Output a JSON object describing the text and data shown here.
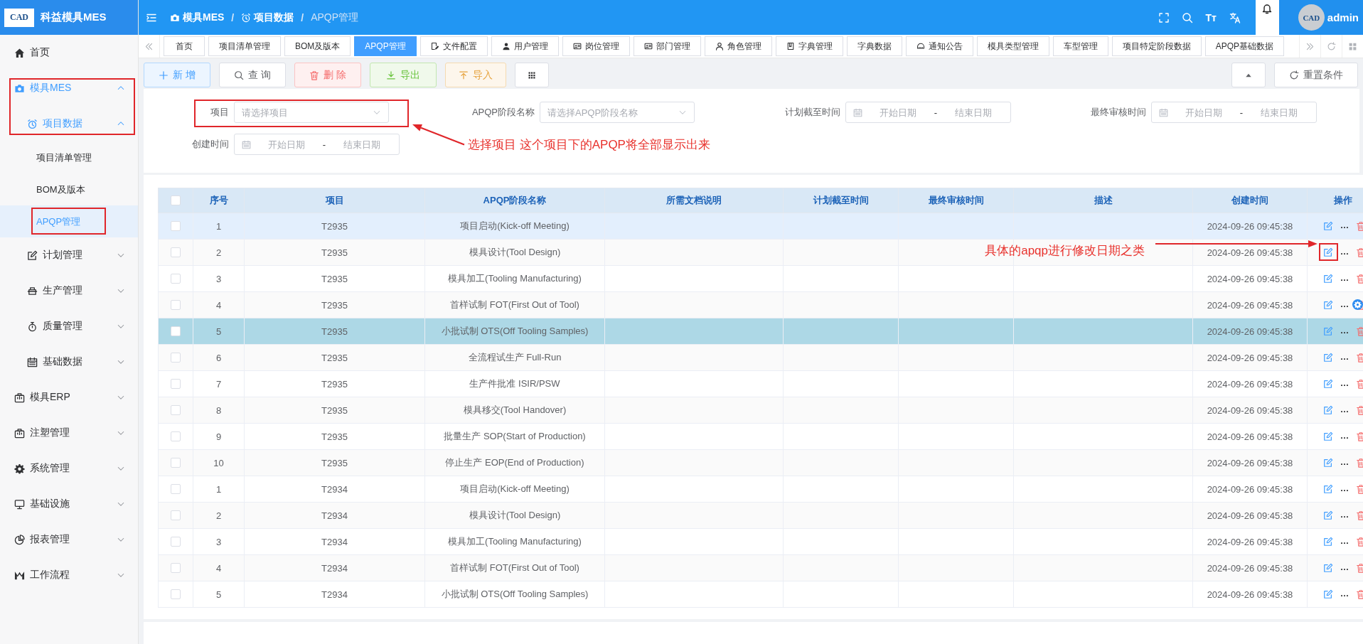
{
  "brand": {
    "logo_text": "CAD",
    "title": "科益模具MES"
  },
  "sidebar": {
    "items": [
      {
        "label": "首页",
        "selected": false,
        "marked": false
      },
      {
        "label": "模具MES",
        "selected": false,
        "expanded": true,
        "marked": true,
        "children": [
          {
            "label": "项目数据",
            "selected": false,
            "expanded": true,
            "marked": true,
            "children": [
              {
                "label": "项目清单管理",
                "selected": false,
                "marked": false
              },
              {
                "label": "BOM及版本",
                "selected": false,
                "marked": false
              },
              {
                "label": "APQP管理",
                "selected": true,
                "marked": true
              }
            ]
          },
          {
            "label": "计划管理",
            "selected": false,
            "expanded": false,
            "marked": false
          },
          {
            "label": "生产管理",
            "selected": false,
            "expanded": false,
            "marked": false
          },
          {
            "label": "质量管理",
            "selected": false,
            "expanded": false,
            "marked": false
          },
          {
            "label": "基础数据",
            "selected": false,
            "expanded": false,
            "marked": false
          }
        ]
      },
      {
        "label": "模具ERP",
        "selected": false,
        "expanded": false,
        "marked": false
      },
      {
        "label": "注塑管理",
        "selected": false,
        "expanded": false,
        "marked": false
      },
      {
        "label": "系统管理",
        "selected": false,
        "expanded": false,
        "marked": false
      },
      {
        "label": "基础设施",
        "selected": false,
        "expanded": false,
        "marked": false
      },
      {
        "label": "报表管理",
        "selected": false,
        "expanded": false,
        "marked": false
      },
      {
        "label": "工作流程",
        "selected": false,
        "expanded": false,
        "marked": false
      }
    ]
  },
  "topbar": {
    "separator": "/",
    "breadcrumbs": [
      {
        "label": "模具MES"
      },
      {
        "label": "项目数据"
      },
      {
        "label": "APQP管理"
      }
    ],
    "text_size_glyph": "Tт",
    "avatar_text": "CAD",
    "user": "admin"
  },
  "tabs": [
    {
      "label": "首页",
      "selected": false
    },
    {
      "label": "项目清单管理",
      "selected": false
    },
    {
      "label": "BOM及版本",
      "selected": false
    },
    {
      "label": "APQP管理",
      "selected": true
    },
    {
      "label": "文件配置",
      "selected": false
    },
    {
      "label": "用户管理",
      "selected": false
    },
    {
      "label": "岗位管理",
      "selected": false
    },
    {
      "label": "部门管理",
      "selected": false
    },
    {
      "label": "角色管理",
      "selected": false
    },
    {
      "label": "字典管理",
      "selected": false
    },
    {
      "label": "字典数据",
      "selected": false
    },
    {
      "label": "通知公告",
      "selected": false
    },
    {
      "label": "模具类型管理",
      "selected": false
    },
    {
      "label": "车型管理",
      "selected": false
    },
    {
      "label": "项目特定阶段数据",
      "selected": false
    },
    {
      "label": "APQP基础数据",
      "selected": false
    }
  ],
  "toolbar": {
    "buttons": [
      {
        "kind": "add",
        "label": "新 增"
      },
      {
        "kind": "query",
        "label": "查 询"
      },
      {
        "kind": "delete",
        "label": "删 除"
      },
      {
        "kind": "export",
        "label": "导出"
      },
      {
        "kind": "import",
        "label": "导入"
      },
      {
        "kind": "columns"
      }
    ],
    "right_buttons": [
      {
        "kind": "collapse"
      },
      {
        "kind": "reset",
        "label": "重置条件"
      }
    ]
  },
  "filters": [
    {
      "kind": "select",
      "label": "项目",
      "placeholder": "请选择项目",
      "marked": true
    },
    {
      "kind": "select",
      "label": "APQP阶段名称",
      "placeholder": "请选择APQP阶段名称"
    },
    {
      "kind": "daterange",
      "label": "计划截至时间",
      "start_placeholder": "开始日期",
      "separator": "-",
      "end_placeholder": "结束日期"
    },
    {
      "kind": "daterange",
      "label": "最终审核时间",
      "start_placeholder": "开始日期",
      "separator": "-",
      "end_placeholder": "结束日期"
    },
    {
      "kind": "daterange",
      "label": "创建时间",
      "start_placeholder": "开始日期",
      "separator": "-",
      "end_placeholder": "结束日期"
    }
  ],
  "table": {
    "columns": [
      {
        "kind": "checkbox",
        "checked": false
      },
      {
        "label": "序号"
      },
      {
        "label": "项目"
      },
      {
        "label": "APQP阶段名称"
      },
      {
        "label": "所需文档说明"
      },
      {
        "label": "计划截至时间"
      },
      {
        "label": "最终审核时间"
      },
      {
        "label": "描述"
      },
      {
        "label": "创建时间"
      },
      {
        "label": "操作"
      }
    ],
    "rows": [
      {
        "no": "1",
        "project": "T2935",
        "stage": "项目启动(Kick-off Meeting)",
        "created": "2024-09-26 09:45:38",
        "checked": false,
        "selected": false,
        "hovered": true,
        "edit_marked": false
      },
      {
        "no": "2",
        "project": "T2935",
        "stage": "模具设计(Tool Design)",
        "created": "2024-09-26 09:45:38",
        "checked": false,
        "selected": false,
        "hovered": false,
        "edit_marked": true
      },
      {
        "no": "3",
        "project": "T2935",
        "stage": "模具加工(Tooling Manufacturing)",
        "created": "2024-09-26 09:45:38",
        "checked": false,
        "selected": false,
        "hovered": false,
        "edit_marked": false
      },
      {
        "no": "4",
        "project": "T2935",
        "stage": "首样试制 FOT(First Out of Tool)",
        "created": "2024-09-26 09:45:38",
        "checked": false,
        "selected": false,
        "hovered": false,
        "edit_marked": false
      },
      {
        "no": "5",
        "project": "T2935",
        "stage": "小批试制 OTS(Off Tooling Samples)",
        "created": "2024-09-26 09:45:38",
        "checked": false,
        "selected": true,
        "hovered": false,
        "edit_marked": false
      },
      {
        "no": "6",
        "project": "T2935",
        "stage": "全流程试生产 Full-Run",
        "created": "2024-09-26 09:45:38",
        "checked": false,
        "selected": false,
        "hovered": false,
        "edit_marked": false
      },
      {
        "no": "7",
        "project": "T2935",
        "stage": "生产件批准 ISIR/PSW",
        "created": "2024-09-26 09:45:38",
        "checked": false,
        "selected": false,
        "hovered": false,
        "edit_marked": false
      },
      {
        "no": "8",
        "project": "T2935",
        "stage": "模具移交(Tool Handover)",
        "created": "2024-09-26 09:45:38",
        "checked": false,
        "selected": false,
        "hovered": false,
        "edit_marked": false
      },
      {
        "no": "9",
        "project": "T2935",
        "stage": "批量生产 SOP(Start of Production)",
        "created": "2024-09-26 09:45:38",
        "checked": false,
        "selected": false,
        "hovered": false,
        "edit_marked": false
      },
      {
        "no": "10",
        "project": "T2935",
        "stage": "停止生产 EOP(End of Production)",
        "created": "2024-09-26 09:45:38",
        "checked": false,
        "selected": false,
        "hovered": false,
        "edit_marked": false
      },
      {
        "no": "1",
        "project": "T2934",
        "stage": "项目启动(Kick-off Meeting)",
        "created": "2024-09-26 09:45:38",
        "checked": false,
        "selected": false,
        "hovered": false,
        "edit_marked": false
      },
      {
        "no": "2",
        "project": "T2934",
        "stage": "模具设计(Tool Design)",
        "created": "2024-09-26 09:45:38",
        "checked": false,
        "selected": false,
        "hovered": false,
        "edit_marked": false
      },
      {
        "no": "3",
        "project": "T2934",
        "stage": "模具加工(Tooling Manufacturing)",
        "created": "2024-09-26 09:45:38",
        "checked": false,
        "selected": false,
        "hovered": false,
        "edit_marked": false
      },
      {
        "no": "4",
        "project": "T2934",
        "stage": "首样试制 FOT(First Out of Tool)",
        "created": "2024-09-26 09:45:38",
        "checked": false,
        "selected": false,
        "hovered": false,
        "edit_marked": false
      },
      {
        "no": "5",
        "project": "T2934",
        "stage": "小批试制 OTS(Off Tooling Samples)",
        "created": "2024-09-26 09:45:38",
        "checked": false,
        "selected": false,
        "hovered": false,
        "edit_marked": false
      }
    ]
  },
  "annotations": [
    {
      "text": "选择项目 这个项目下的APQP将全部显示出来"
    },
    {
      "text": "具体的apqp进行修改日期之类"
    }
  ]
}
